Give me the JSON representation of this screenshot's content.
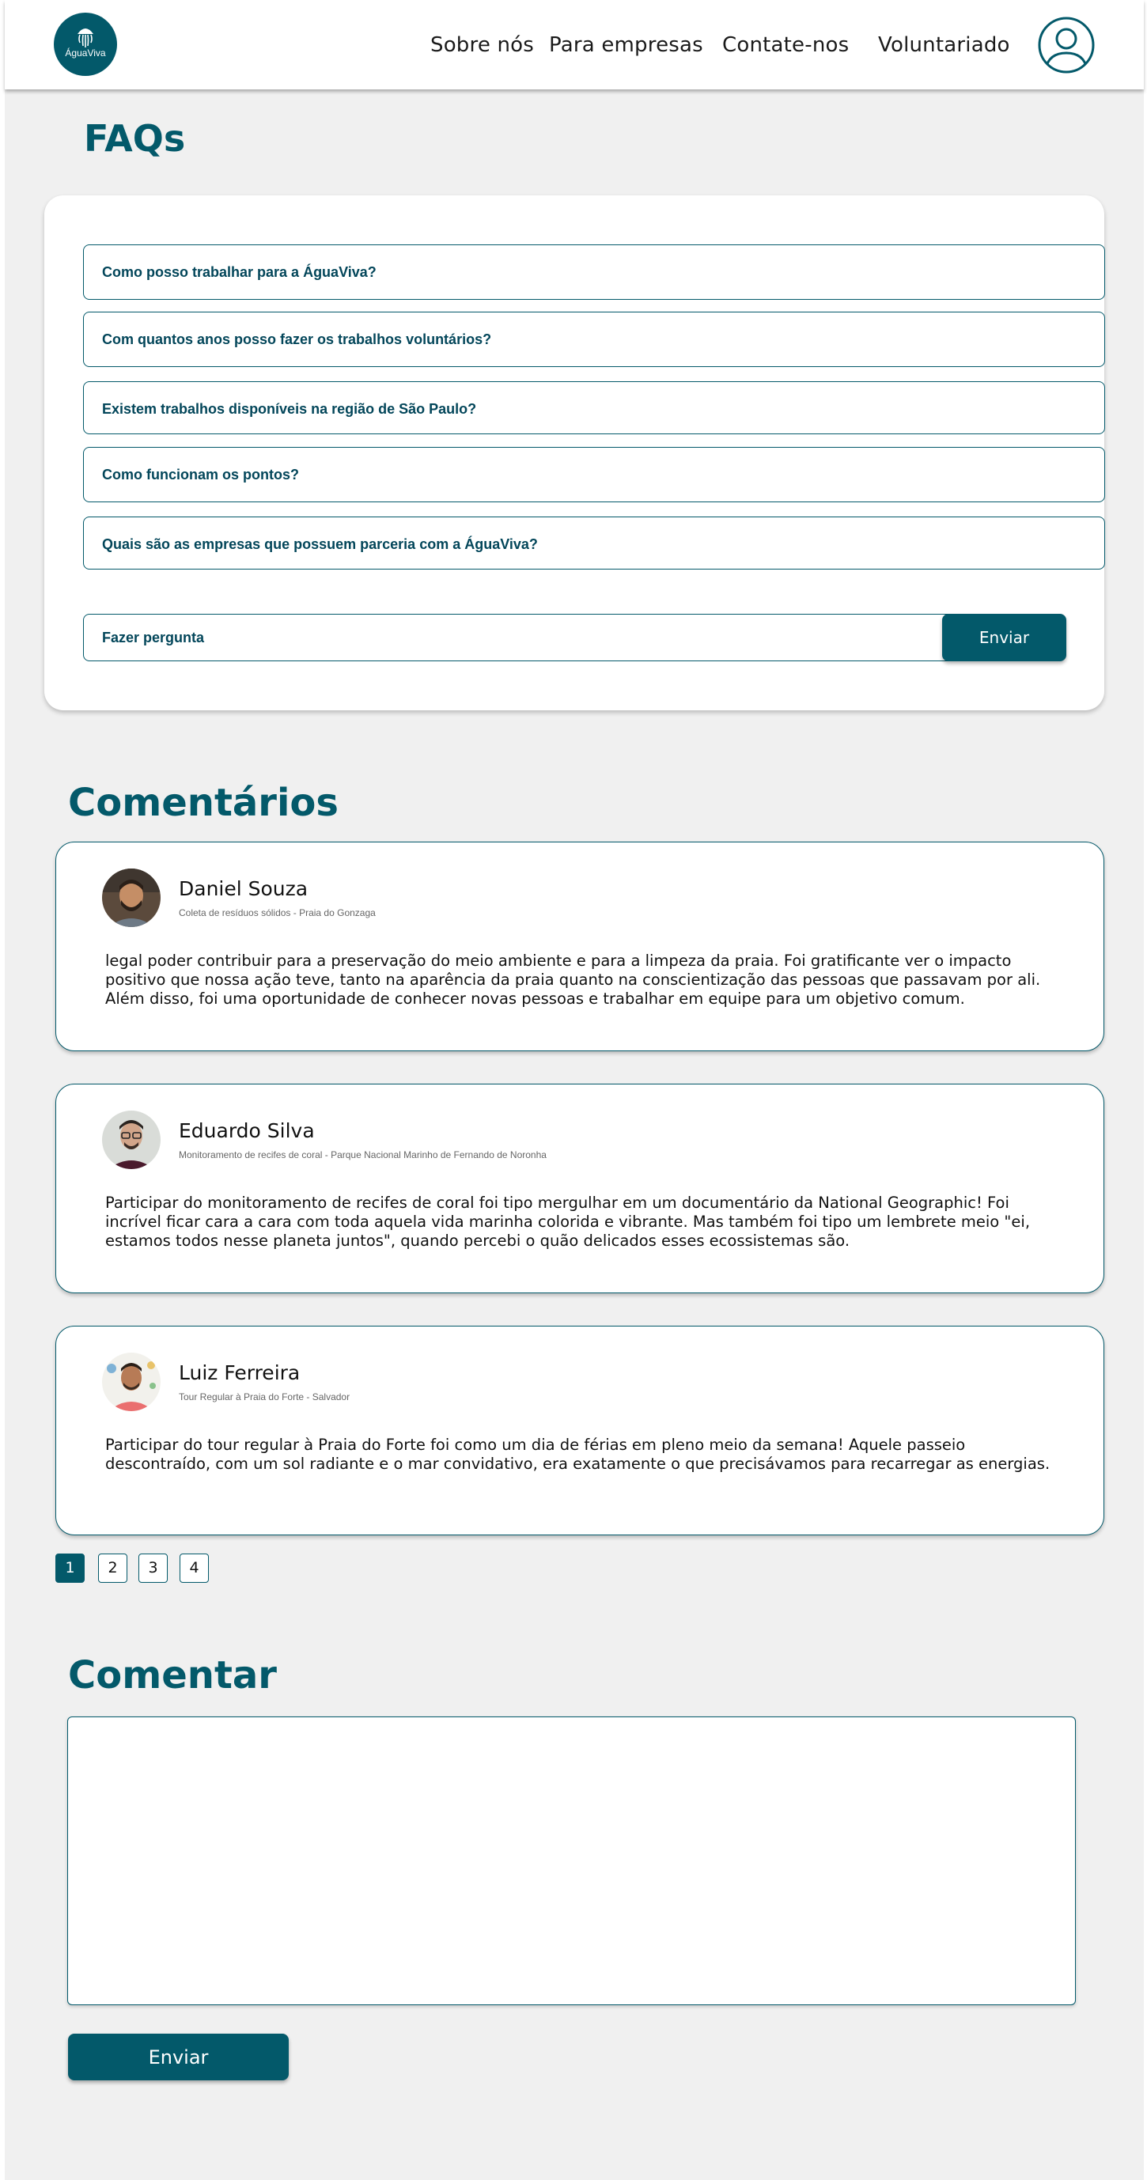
{
  "header": {
    "logo_text": "ÁguaViva",
    "nav": [
      "Sobre nós",
      "Para empresas",
      "Contate-nos",
      "Voluntariado"
    ]
  },
  "faq": {
    "title": "FAQs",
    "questions": [
      "Como posso trabalhar para a ÁguaViva?",
      "Com quantos anos posso fazer os trabalhos voluntários?",
      "Existem trabalhos disponíveis na região de São Paulo?",
      "Como funcionam os pontos?",
      "Quais são as empresas que possuem parceria com a ÁguaViva?"
    ],
    "ask_placeholder": "Fazer pergunta",
    "send_label": "Enviar"
  },
  "comments": {
    "title": "Comentários",
    "items": [
      {
        "name": "Daniel Souza",
        "subtitle": "Coleta de resíduos sólidos - Praia do Gonzaga",
        "text": "legal poder contribuir para a preservação do meio ambiente e para a limpeza da praia. Foi gratificante ver o impacto positivo que nossa ação teve, tanto na aparência da praia quanto na conscientização das pessoas que passavam por ali. Além disso, foi uma oportunidade de conhecer novas pessoas e trabalhar em equipe para um objetivo comum."
      },
      {
        "name": "Eduardo Silva",
        "subtitle": "Monitoramento de recifes de coral  - Parque Nacional Marinho de Fernando de Noronha",
        "text": "Participar do monitoramento de recifes de coral foi tipo mergulhar em um documentário da National Geographic! Foi incrível ficar cara a cara com toda aquela vida marinha colorida e vibrante. Mas também foi tipo um lembrete meio \"ei, estamos todos nesse planeta juntos\", quando percebi o quão delicados esses ecossistemas são."
      },
      {
        "name": "Luiz Ferreira",
        "subtitle": "Tour Regular à Praia do Forte - Salvador",
        "text": "Participar do tour regular à Praia do Forte foi como um dia de férias em pleno meio da semana! Aquele passeio descontraído, com um sol radiante e o mar convidativo, era exatamente o que precisávamos para recarregar as energias."
      }
    ],
    "pages": [
      "1",
      "2",
      "3",
      "4"
    ],
    "active_page": "1"
  },
  "comment_form": {
    "title": "Comentar",
    "send_label": "Enviar"
  },
  "colors": {
    "primary": "#03596a",
    "background": "#f0f0f0"
  }
}
